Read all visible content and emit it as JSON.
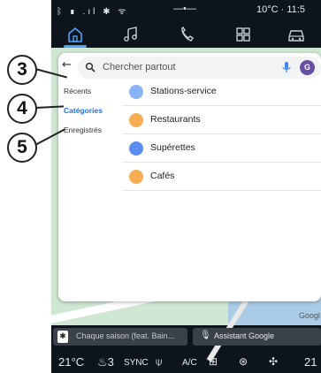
{
  "status": {
    "left_icons": "ᛒ ▮ .ıl ✱ ᯤ",
    "center": "—•—",
    "right": "10°C · 11:5"
  },
  "nav": {
    "items": [
      "home-icon",
      "apps-icon",
      "phone-icon",
      "grid-icon",
      "car-icon"
    ]
  },
  "search": {
    "back": "←",
    "placeholder": "Chercher partout",
    "avatar_letter": "G"
  },
  "sidebar": {
    "items": [
      {
        "label": "Récents"
      },
      {
        "label": "Catégories"
      },
      {
        "label": "Enregistrés"
      }
    ]
  },
  "categories": [
    {
      "label": "Stations-service",
      "color": "#8ab4f8"
    },
    {
      "label": "Restaurants",
      "color": "#f6ad55"
    },
    {
      "label": "Supérettes",
      "color": "#5b8def"
    },
    {
      "label": "Cafés",
      "color": "#f6ad55"
    }
  ],
  "map": {
    "attribution": "Googl"
  },
  "media": {
    "song": "Chaque saison (feat. Bain...",
    "assistant": "Assistant Google"
  },
  "climate": {
    "temp_left": "21°C",
    "seat": "♨3",
    "sync": "SYNC",
    "ac": "A/C",
    "temp_right": "21"
  },
  "callouts": [
    "3",
    "4",
    "5"
  ]
}
